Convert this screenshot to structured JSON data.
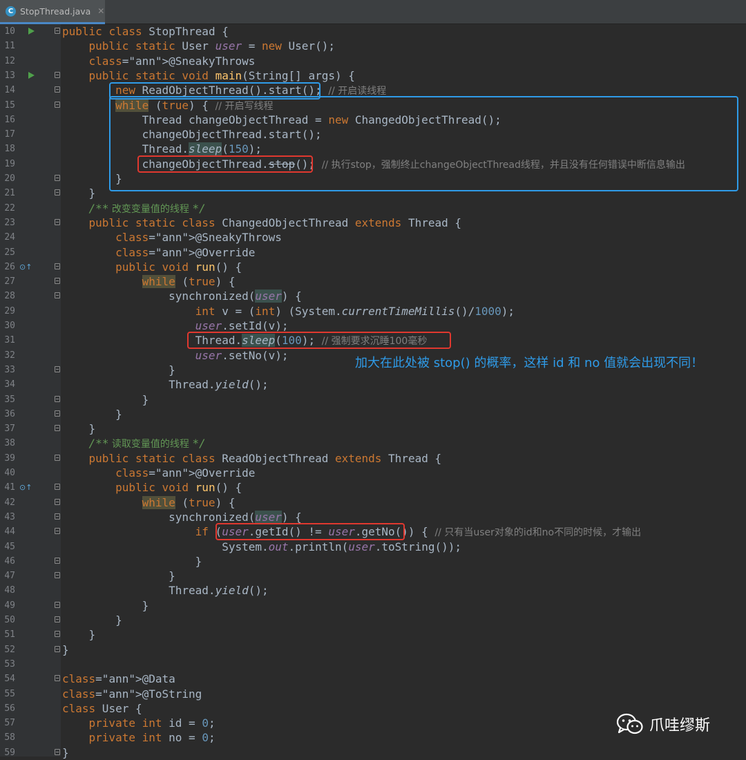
{
  "tab": {
    "title": "StopThread.java",
    "icon": "C",
    "close": "✕"
  },
  "annotation": "加大在此处被 stop() 的概率，这样 id 和 no 值就会出现不同！",
  "watermark": {
    "label": "爪哇缪斯",
    "icon": "wechat-icon"
  },
  "colors": {
    "keyword": "#cc7832",
    "field": "#9876aa",
    "number": "#6897bb",
    "annotation": "#bbb529",
    "comment": "#808080",
    "doc": "#629755",
    "box_blue": "#2f9be8",
    "box_red": "#e0382f"
  },
  "lines": [
    {
      "n": 10,
      "code": "public class StopThread {"
    },
    {
      "n": 11,
      "code": "    public static User user = new User();"
    },
    {
      "n": 12,
      "code": "    @SneakyThrows"
    },
    {
      "n": 13,
      "code": "    public static void main(String[] args) {"
    },
    {
      "n": 14,
      "code": "        new ReadObjectThread().start(); // 开启读线程"
    },
    {
      "n": 15,
      "code": "        while (true) { // 开启写线程"
    },
    {
      "n": 16,
      "code": "            Thread changeObjectThread = new ChangedObjectThread();"
    },
    {
      "n": 17,
      "code": "            changeObjectThread.start();"
    },
    {
      "n": 18,
      "code": "            Thread.sleep(150);"
    },
    {
      "n": 19,
      "code": "            changeObjectThread.stop(); // 执行stop，强制终止changeObjectThread线程，并且没有任何错误中断信息输出"
    },
    {
      "n": 20,
      "code": "        }"
    },
    {
      "n": 21,
      "code": "    }"
    },
    {
      "n": 22,
      "code": "    /** 改变变量值的线程 */"
    },
    {
      "n": 23,
      "code": "    public static class ChangedObjectThread extends Thread {"
    },
    {
      "n": 24,
      "code": "        @SneakyThrows"
    },
    {
      "n": 25,
      "code": "        @Override"
    },
    {
      "n": 26,
      "code": "        public void run() {"
    },
    {
      "n": 27,
      "code": "            while (true) {"
    },
    {
      "n": 28,
      "code": "                synchronized(user) {"
    },
    {
      "n": 29,
      "code": "                    int v = (int) (System.currentTimeMillis()/1000);"
    },
    {
      "n": 30,
      "code": "                    user.setId(v);"
    },
    {
      "n": 31,
      "code": "                    Thread.sleep(100); // 强制要求沉睡100毫秒"
    },
    {
      "n": 32,
      "code": "                    user.setNo(v);"
    },
    {
      "n": 33,
      "code": "                }"
    },
    {
      "n": 34,
      "code": "                Thread.yield();"
    },
    {
      "n": 35,
      "code": "            }"
    },
    {
      "n": 36,
      "code": "        }"
    },
    {
      "n": 37,
      "code": "    }"
    },
    {
      "n": 38,
      "code": "    /** 读取变量值的线程 */"
    },
    {
      "n": 39,
      "code": "    public static class ReadObjectThread extends Thread {"
    },
    {
      "n": 40,
      "code": "        @Override"
    },
    {
      "n": 41,
      "code": "        public void run() {"
    },
    {
      "n": 42,
      "code": "            while (true) {"
    },
    {
      "n": 43,
      "code": "                synchronized(user) {"
    },
    {
      "n": 44,
      "code": "                    if (user.getId() != user.getNo()) { // 只有当user对象的id和no不同的时候，才输出"
    },
    {
      "n": 45,
      "code": "                        System.out.println(user.toString());"
    },
    {
      "n": 46,
      "code": "                    }"
    },
    {
      "n": 47,
      "code": "                }"
    },
    {
      "n": 48,
      "code": "                Thread.yield();"
    },
    {
      "n": 49,
      "code": "            }"
    },
    {
      "n": 50,
      "code": "        }"
    },
    {
      "n": 51,
      "code": "    }"
    },
    {
      "n": 52,
      "code": "}"
    },
    {
      "n": 53,
      "code": ""
    },
    {
      "n": 54,
      "code": "@Data"
    },
    {
      "n": 55,
      "code": "@ToString"
    },
    {
      "n": 56,
      "code": "class User {"
    },
    {
      "n": 57,
      "code": "    private int id = 0;"
    },
    {
      "n": 58,
      "code": "    private int no = 0;"
    },
    {
      "n": 59,
      "code": "}"
    }
  ]
}
